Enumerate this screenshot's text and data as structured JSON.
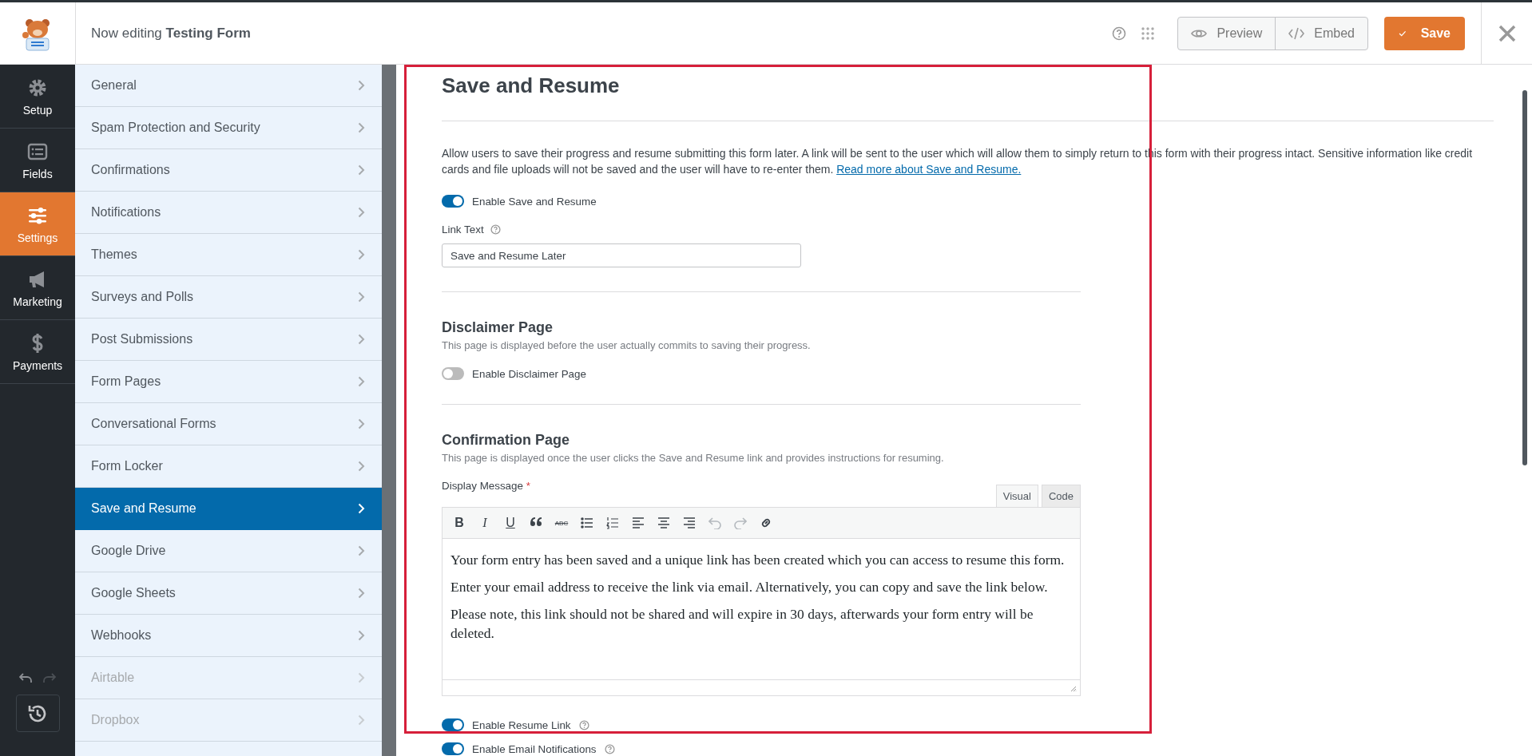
{
  "header": {
    "prefix": "Now editing",
    "form_name": "Testing Form",
    "preview": "Preview",
    "embed": "Embed",
    "save": "Save"
  },
  "rail": [
    {
      "label": "Setup",
      "selected": false
    },
    {
      "label": "Fields",
      "selected": false
    },
    {
      "label": "Settings",
      "selected": true
    },
    {
      "label": "Marketing",
      "selected": false
    },
    {
      "label": "Payments",
      "selected": false
    }
  ],
  "settings_menu": [
    {
      "label": "General",
      "selected": false,
      "disabled": false
    },
    {
      "label": "Spam Protection and Security",
      "selected": false,
      "disabled": false
    },
    {
      "label": "Confirmations",
      "selected": false,
      "disabled": false
    },
    {
      "label": "Notifications",
      "selected": false,
      "disabled": false
    },
    {
      "label": "Themes",
      "selected": false,
      "disabled": false
    },
    {
      "label": "Surveys and Polls",
      "selected": false,
      "disabled": false
    },
    {
      "label": "Post Submissions",
      "selected": false,
      "disabled": false
    },
    {
      "label": "Form Pages",
      "selected": false,
      "disabled": false
    },
    {
      "label": "Conversational Forms",
      "selected": false,
      "disabled": false
    },
    {
      "label": "Form Locker",
      "selected": false,
      "disabled": false
    },
    {
      "label": "Save and Resume",
      "selected": true,
      "disabled": false
    },
    {
      "label": "Google Drive",
      "selected": false,
      "disabled": false
    },
    {
      "label": "Google Sheets",
      "selected": false,
      "disabled": false
    },
    {
      "label": "Webhooks",
      "selected": false,
      "disabled": false
    },
    {
      "label": "Airtable",
      "selected": false,
      "disabled": true
    },
    {
      "label": "Dropbox",
      "selected": false,
      "disabled": true
    }
  ],
  "panel": {
    "title": "Save and Resume",
    "description": "Allow users to save their progress and resume submitting this form later. A link will be sent to the user which will allow them to simply return to this form with their progress intact. Sensitive information like credit cards and file uploads will not be saved and the user will have to re-enter them.",
    "read_more": "Read more about Save and Resume.",
    "enable_toggle": {
      "label": "Enable Save and Resume",
      "on": true
    },
    "link_text": {
      "label": "Link Text",
      "value": "Save and Resume Later"
    },
    "disclaimer": {
      "title": "Disclaimer Page",
      "description": "This page is displayed before the user actually commits to saving their progress.",
      "toggle": {
        "label": "Enable Disclaimer Page",
        "on": false
      }
    },
    "confirmation": {
      "title": "Confirmation Page",
      "description": "This page is displayed once the user clicks the Save and Resume link and provides instructions for resuming.",
      "message_label": "Display Message",
      "required_mark": "*",
      "editor_tabs": [
        {
          "label": "Visual",
          "selected": true
        },
        {
          "label": "Code",
          "selected": false
        }
      ],
      "toolbar": [
        {
          "kind": "text",
          "label": "B",
          "disabled": false
        },
        {
          "kind": "text",
          "label": "I",
          "disabled": false
        },
        {
          "kind": "text",
          "label": "U",
          "disabled": false
        },
        {
          "kind": "quote",
          "disabled": false
        },
        {
          "kind": "text",
          "label": "ABC",
          "disabled": false
        },
        {
          "kind": "bullets",
          "disabled": false
        },
        {
          "kind": "numbers",
          "disabled": false
        },
        {
          "kind": "align-left",
          "disabled": false
        },
        {
          "kind": "align-center",
          "disabled": false
        },
        {
          "kind": "align-right",
          "disabled": false
        },
        {
          "kind": "undo",
          "disabled": true
        },
        {
          "kind": "redo",
          "disabled": true
        },
        {
          "kind": "link",
          "disabled": false
        }
      ],
      "paragraphs": [
        "Your form entry has been saved and a unique link has been created which you can access to resume this form.",
        "Enter your email address to receive the link via email. Alternatively, you can copy and save the link below.",
        "Please note, this link should not be shared and will expire in 30 days, afterwards your form entry will be deleted."
      ]
    },
    "toggles": [
      {
        "label": "Enable Resume Link",
        "on": true
      },
      {
        "label": "Enable Email Notifications",
        "on": true
      }
    ]
  }
}
